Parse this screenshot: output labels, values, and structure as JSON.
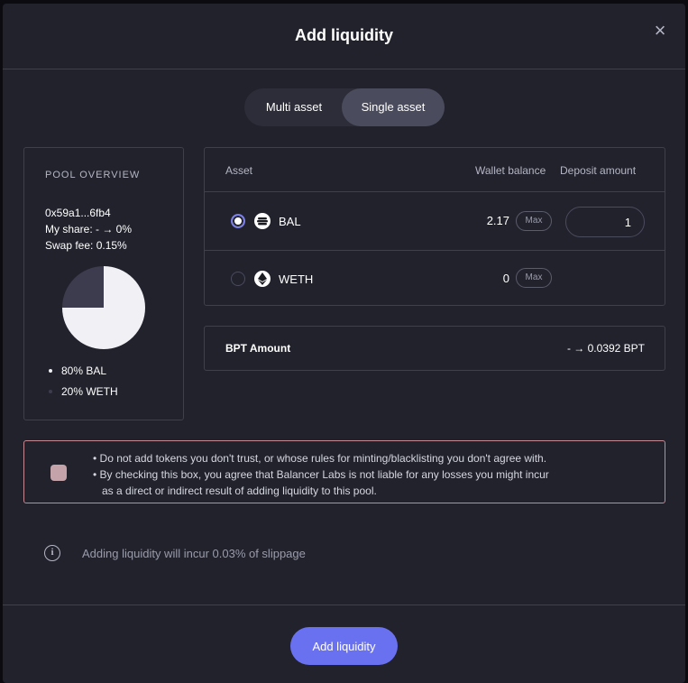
{
  "modal": {
    "title": "Add liquidity",
    "close_icon": "close-icon"
  },
  "mode_toggle": {
    "options": [
      "Multi asset",
      "Single asset"
    ],
    "selected": "Single asset"
  },
  "pool_overview": {
    "heading": "POOL OVERVIEW",
    "address": "0x59a1...6fb4",
    "my_share": "My share: - → 0%",
    "swap_fee": "Swap fee: 0.15%",
    "composition": [
      {
        "label": "80% BAL",
        "percent": 80,
        "color": "#f0f0f5"
      },
      {
        "label": "20% WETH",
        "percent": 20,
        "color": "#3d3c4f"
      }
    ]
  },
  "assets_table": {
    "headers": {
      "asset": "Asset",
      "wallet_balance": "Wallet balance",
      "deposit_amount": "Deposit amount"
    },
    "rows": [
      {
        "symbol": "BAL",
        "icon": "bal-token-icon",
        "balance": "2.17",
        "max_label": "Max",
        "deposit": "1",
        "selected": true
      },
      {
        "symbol": "WETH",
        "icon": "eth-token-icon",
        "balance": "0",
        "max_label": "Max",
        "deposit": "",
        "selected": false
      }
    ]
  },
  "bpt": {
    "label": "BPT Amount",
    "value": "- → 0.0392 BPT"
  },
  "warning": {
    "line1": "• Do not add tokens you don't trust, or whose rules for minting/blacklisting you don't agree with.",
    "line2": "• By checking this box, you agree that Balancer Labs is not liable for any losses you might incur",
    "line3": "as a direct or indirect result of adding liquidity to this pool.",
    "checked": false
  },
  "slippage": {
    "icon": "info-icon",
    "text": "Adding liquidity will incur 0.03% of slippage"
  },
  "footer": {
    "submit_label": "Add liquidity"
  },
  "colors": {
    "background": "#21222c",
    "accent": "#6a71f1",
    "border": "#3f404a",
    "warning_border": "#c48a93"
  }
}
